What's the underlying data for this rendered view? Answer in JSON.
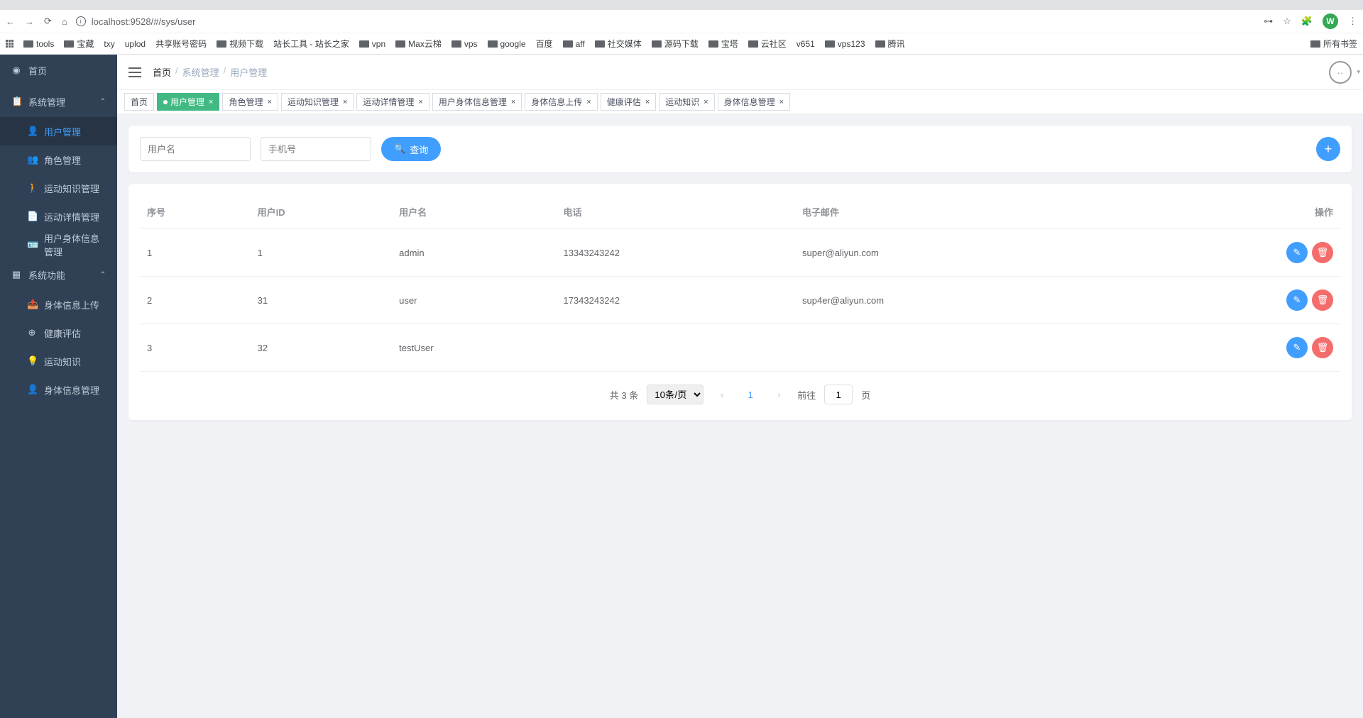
{
  "browser": {
    "url": "localhost:9528/#/sys/user",
    "avatar_letter": "W",
    "bookmarks": [
      "tools",
      "宝藏",
      "txy",
      "uplod",
      "共享账号密码",
      "视频下载",
      "站长工具 - 站长之家",
      "vpn",
      "Max云梯",
      "vps",
      "google",
      "百度",
      "aff",
      "社交媒体",
      "源码下载",
      "宝塔",
      "云社区",
      "v651",
      "vps123",
      "腾讯"
    ],
    "all_bookmarks": "所有书签"
  },
  "breadcrumb": {
    "home": "首页",
    "section": "系统管理",
    "page": "用户管理"
  },
  "sidebar": {
    "home": "首页",
    "sys_mgmt": "系统管理",
    "sys_items": [
      "用户管理",
      "角色管理",
      "运动知识管理",
      "运动详情管理",
      "用户身体信息管理"
    ],
    "sys_func": "系统功能",
    "func_items": [
      "身体信息上传",
      "健康评估",
      "运动知识",
      "身体信息管理"
    ]
  },
  "tags": [
    "首页",
    "用户管理",
    "角色管理",
    "运动知识管理",
    "运动详情管理",
    "用户身体信息管理",
    "身体信息上传",
    "健康评估",
    "运动知识",
    "身体信息管理"
  ],
  "search": {
    "ph_user": "用户名",
    "ph_phone": "手机号",
    "btn": "查询"
  },
  "table": {
    "headers": [
      "序号",
      "用户ID",
      "用户名",
      "电话",
      "电子邮件",
      "操作"
    ],
    "rows": [
      {
        "seq": "1",
        "uid": "1",
        "name": "admin",
        "phone": "13343243242",
        "email": "super@aliyun.com"
      },
      {
        "seq": "2",
        "uid": "31",
        "name": "user",
        "phone": "17343243242",
        "email": "sup4er@aliyun.com"
      },
      {
        "seq": "3",
        "uid": "32",
        "name": "testUser",
        "phone": "",
        "email": ""
      }
    ]
  },
  "pager": {
    "total": "共 3 条",
    "size": "10条/页",
    "page": "1",
    "goto_pre": "前往",
    "goto_val": "1",
    "goto_suf": "页"
  }
}
